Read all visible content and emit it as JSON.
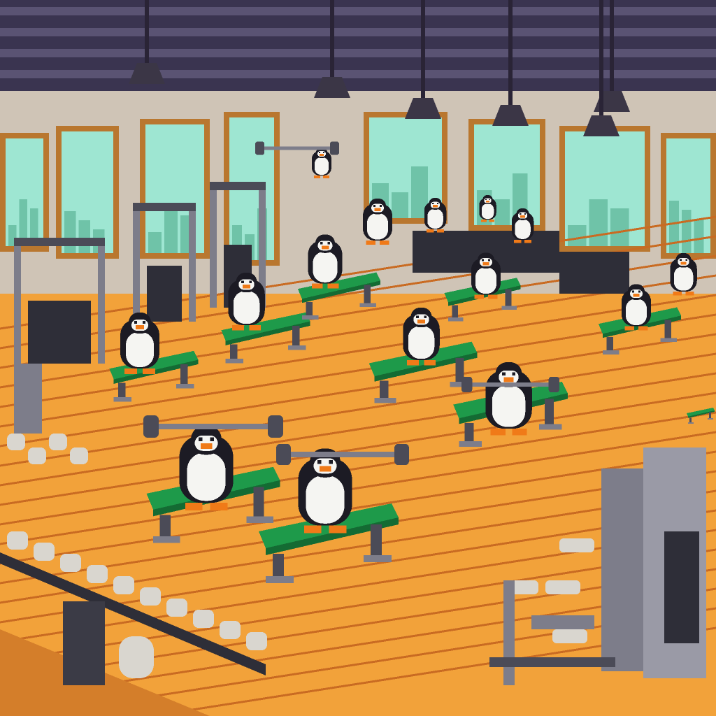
{
  "scene": {
    "subject": "penguins-working-out-in-gym",
    "style": "pixel-art",
    "palette": {
      "ceiling": "#3a3450",
      "beam": "#5a5373",
      "wall": "#cfc4b6",
      "window_sky": "#9ee6d2",
      "window_frame": "#b9772f",
      "skyline": "#6fc3a8",
      "floor": "#f2a23a",
      "floor_dark": "#d47e2a",
      "floor_line": "#c96b22",
      "bench_pad": "#1e9a4a",
      "bench_pad_dark": "#146b33",
      "metal": "#7d7d8a",
      "metal_dark": "#4b4b57",
      "penguin_black": "#1c1b24",
      "penguin_white": "#f5f5f2",
      "beak": "#f07a18",
      "plate": "#d9d6cf"
    }
  }
}
